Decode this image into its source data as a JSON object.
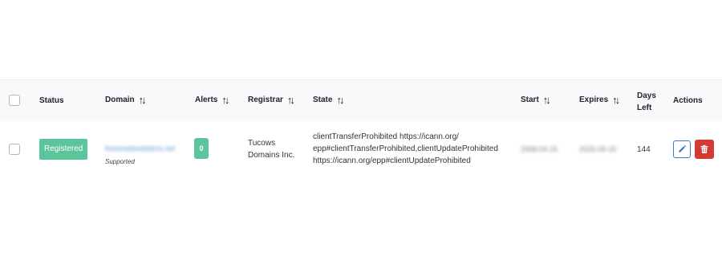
{
  "table": {
    "headers": {
      "status": "Status",
      "domain": "Domain",
      "alerts": "Alerts",
      "registrar": "Registrar",
      "state": "State",
      "start": "Start",
      "expires": "Expires",
      "days_left_line1": "Days",
      "days_left_line2": "Left",
      "actions": "Actions"
    },
    "sort_glyph": "↑↓",
    "rows": [
      {
        "status": "Registered",
        "domain": "foreshadowlistens.net",
        "domain_note": "Supported",
        "alerts": "0",
        "registrar_line1": "Tucows",
        "registrar_line2": "Domains Inc.",
        "state_line1": "clientTransferProhibited https://icann.org/",
        "state_line2": "epp#clientTransferProhibited,clientUpdateProhibited",
        "state_line3": "https://icann.org/epp#clientUpdateProhibited",
        "start": "2008-04-15",
        "expires": "2025-04-15",
        "days_left": "144"
      }
    ]
  },
  "icons": {
    "edit": "pencil-icon",
    "delete": "trash-icon",
    "sort": "sort-arrows-icon"
  },
  "colors": {
    "status_badge": "#5cc49a",
    "edit_border": "#3f78c2",
    "delete_bg": "#d33a35",
    "header_bg": "#f8f9fb"
  }
}
